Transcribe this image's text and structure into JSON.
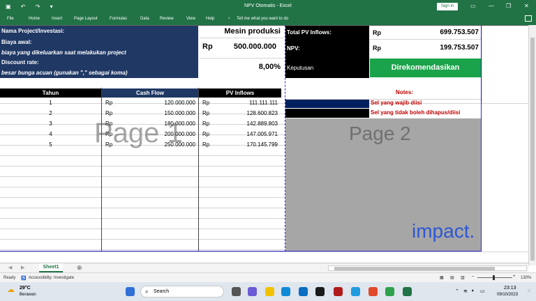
{
  "window": {
    "title": "NPV Otomatis  -  Excel",
    "signin_label": "Sign in"
  },
  "ribbon": {
    "tabs": [
      "File",
      "Home",
      "Insert",
      "Page Layout",
      "Formulas",
      "Data",
      "Review",
      "View",
      "Help"
    ],
    "tell_me": "Tell me what you want to do"
  },
  "form": {
    "project_label": "Nama Project/Investasi:",
    "project_value": "Mesin produksi",
    "biaya_label": "Biaya awal:",
    "biaya_desc": "biaya yang dikeluarkan saat melakukan project",
    "biaya_currency": "Rp",
    "biaya_value": "500.000.000",
    "discount_label": "Discount rate:",
    "discount_desc": "besar bunga acuan  (gunakan \",\" sebagai koma)",
    "discount_value": "8,00%"
  },
  "summary": {
    "total_label": "Total PV Inflows:",
    "total_currency": "Rp",
    "total_value": "699.753.507",
    "npv_label": "NPV:",
    "npv_currency": "Rp",
    "npv_value": "199.753.507",
    "keputusan_label": "Keputusan",
    "keputusan_value": "Direkomendasikan"
  },
  "table": {
    "headers": [
      "Tahun",
      "Cash Flow",
      "PV Inflows"
    ],
    "rows": [
      {
        "tahun": "1",
        "cf_rp": "Rp",
        "cf": "120.000.000",
        "pv_rp": "Rp",
        "pv": "111.111.111"
      },
      {
        "tahun": "2",
        "cf_rp": "Rp",
        "cf": "150.000.000",
        "pv_rp": "Rp",
        "pv": "128.600.823"
      },
      {
        "tahun": "3",
        "cf_rp": "Rp",
        "cf": "180.000.000",
        "pv_rp": "Rp",
        "pv": "142.889.803"
      },
      {
        "tahun": "4",
        "cf_rp": "Rp",
        "cf": "200.000.000",
        "pv_rp": "Rp",
        "pv": "147.005.971"
      },
      {
        "tahun": "5",
        "cf_rp": "Rp",
        "cf": "250.000.000",
        "pv_rp": "Rp",
        "pv": "170.145.799"
      }
    ]
  },
  "notes": {
    "title": "Notes:",
    "required": "Sel yang wajib diisi",
    "locked": "Sel yang tidak boleh dihapus/diisi"
  },
  "watermarks": {
    "page1": "Page 1",
    "page2": "Page 2"
  },
  "brand": "impact.",
  "sheet": {
    "tab": "Sheet1"
  },
  "status": {
    "ready": "Ready",
    "accessibility": "Accessibility: Investigate",
    "zoom": "130%"
  },
  "taskbar": {
    "weather_temp": "29°C",
    "weather_desc": "Berawan",
    "search": "Search",
    "time": "23:13",
    "date": "09/10/2023"
  },
  "colors": {
    "excel_green": "#217346",
    "navy": "#1f3864",
    "decision_green": "#1aa34a",
    "notes_red": "#c00000",
    "page_break": "#2b2bd0"
  }
}
